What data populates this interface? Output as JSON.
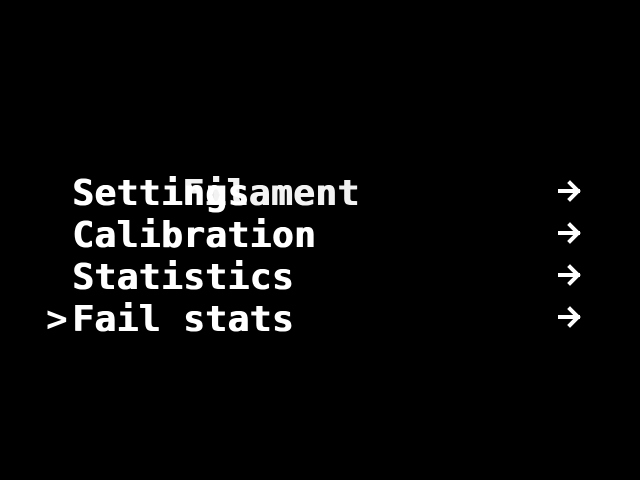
{
  "menu": {
    "cursor": ">",
    "items": [
      {
        "label": "Settings",
        "overlay": "Filament"
      },
      {
        "label": "Calibration",
        "overlay": ""
      },
      {
        "label": "Statistics",
        "overlay": ""
      },
      {
        "label": "Fail stats",
        "overlay": ""
      }
    ],
    "arrow_icon": "arrow-right-icon",
    "selected_index": 3
  },
  "colors": {
    "background": "#000000",
    "foreground": "#ffffff"
  }
}
